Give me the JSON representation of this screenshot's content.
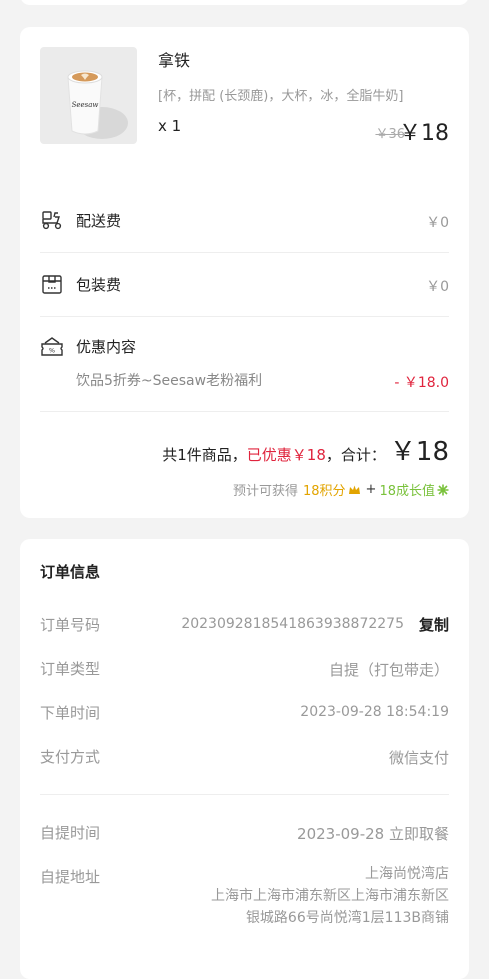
{
  "product": {
    "name": "拿铁",
    "spec": "[杯，拼配 (长颈鹿)，大杯，冰，全脂牛奶]",
    "qty": "x 1",
    "original_price": "￥36",
    "price": "￥18",
    "cup_brand": "Seesaw"
  },
  "fees": {
    "delivery_label": "配送费",
    "delivery_value": "￥0",
    "packing_label": "包装费",
    "packing_value": "￥0"
  },
  "discount": {
    "label": "优惠内容",
    "desc": "饮品5折券~Seesaw老粉福利",
    "value": "- ￥18.0"
  },
  "summary": {
    "count_text": "共1件商品，",
    "discounted_text": "已优惠￥18",
    "total_label": "，合计：",
    "total": "￥18",
    "earn_prefix": "预计可获得",
    "points": "18积分",
    "plus": "+",
    "growth": "18成长值"
  },
  "order": {
    "title": "订单信息",
    "number_label": "订单号码",
    "number_value": "20230928185418639388722​75",
    "copy_label": "复制",
    "type_label": "订单类型",
    "type_value": "自提（打包带走）",
    "time_label": "下单时间",
    "time_value": "2023-09-28 18:54:19",
    "pay_label": "支付方式",
    "pay_value": "微信支付",
    "pickup_time_label": "自提时间",
    "pickup_time_value": "2023-09-28 立即取餐",
    "pickup_addr_label": "自提地址",
    "pickup_store": "上海尚悦湾店",
    "pickup_addr_line1": "上海市上海市浦东新区上海市浦东新区",
    "pickup_addr_line2": "银城路66号尚悦湾1层113B商铺"
  },
  "colors": {
    "accent_red": "#e0243d",
    "points_yellow": "#e2a400",
    "growth_green": "#7ac23c"
  }
}
